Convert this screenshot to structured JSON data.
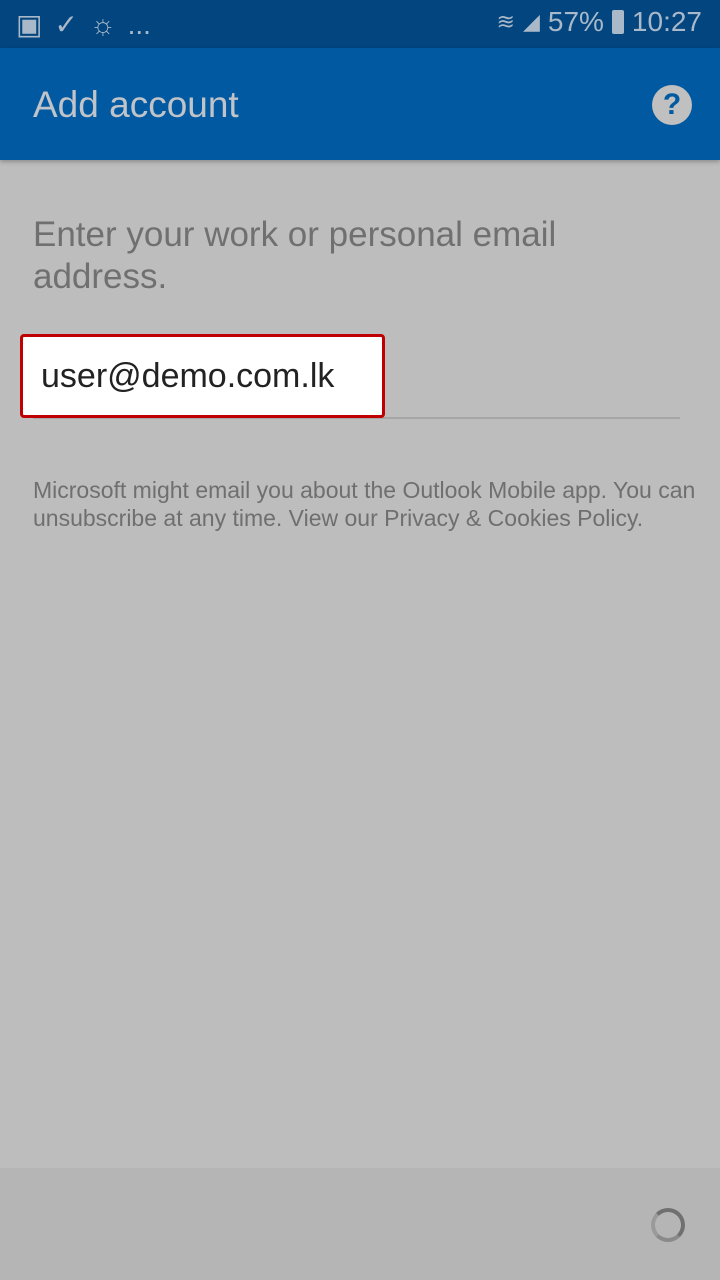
{
  "status_bar": {
    "notif_icons": [
      "gallery-icon",
      "task-check-icon",
      "weather-icon"
    ],
    "more": "...",
    "battery": "57%",
    "time": "10:27"
  },
  "app_bar": {
    "title": "Add account",
    "help_icon": "question-circle-icon"
  },
  "form": {
    "prompt": "Enter your work or personal email address.",
    "email_value": "user@demo.com.lk",
    "highlight_color": "#c00000"
  },
  "notice": "Microsoft might email you about the Outlook Mobile app. You can unsubscribe at any time. View our Privacy & Cookies Policy.",
  "footer": {
    "loading_icon": "spinner-icon"
  },
  "colors": {
    "status_bar": "#02457f",
    "app_bar": "#0059a1",
    "background": "#bdbdbd"
  }
}
